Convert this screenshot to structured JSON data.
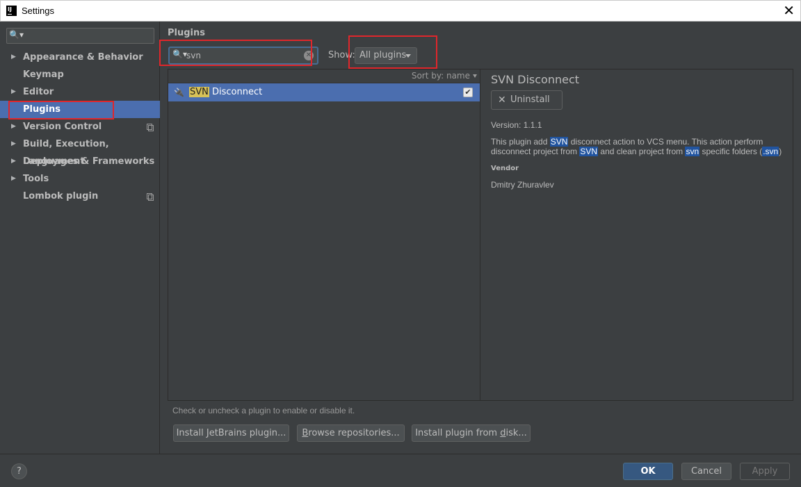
{
  "window": {
    "app_icon": "IJ",
    "title": "Settings",
    "close_glyph": "✕"
  },
  "sidebar": {
    "search_icon": "search-icon",
    "items": [
      {
        "label": "Appearance & Behavior",
        "expandable": true
      },
      {
        "label": "Keymap",
        "expandable": false
      },
      {
        "label": "Editor",
        "expandable": true
      },
      {
        "label": "Plugins",
        "expandable": false,
        "selected": true
      },
      {
        "label": "Version Control",
        "expandable": true,
        "project_scope": true
      },
      {
        "label": "Build, Execution, Deployment",
        "expandable": true
      },
      {
        "label": "Languages & Frameworks",
        "expandable": true
      },
      {
        "label": "Tools",
        "expandable": true
      },
      {
        "label": "Lombok plugin",
        "expandable": false,
        "project_scope": true
      }
    ]
  },
  "plugins": {
    "title": "Plugins",
    "search": {
      "value": "svn"
    },
    "show_label": "Show:",
    "show_value": "All plugins",
    "sort_label": "Sort by: name",
    "list": [
      {
        "highlight": "SVN",
        "rest": " Disconnect",
        "enabled": true
      }
    ],
    "detail": {
      "title": "SVN Disconnect",
      "uninstall_label": "Uninstall",
      "version": "Version: 1.1.1",
      "desc_parts": [
        {
          "t": "This plugin add ",
          "h": false
        },
        {
          "t": "SVN",
          "h": true
        },
        {
          "t": " disconnect action to VCS menu. This action perform disconnect project from ",
          "h": false
        },
        {
          "t": "SVN",
          "h": true
        },
        {
          "t": " and clean project from ",
          "h": false
        },
        {
          "t": "svn",
          "h": true
        },
        {
          "t": " specific folders (",
          "h": false
        },
        {
          "t": ".svn",
          "h": true
        },
        {
          "t": ")",
          "h": false
        }
      ],
      "vendor_label": "Vendor",
      "vendor": "Dmitry Zhuravlev"
    },
    "hint": "Check or uncheck a plugin to enable or disable it.",
    "buttons": {
      "install_jetbrains_pre": "Install ",
      "install_jetbrains_mn": "J",
      "install_jetbrains_post": "etBrains plugin...",
      "browse_pre": "",
      "browse_mn": "B",
      "browse_post": "rowse repositories...",
      "install_disk_pre": "Install plugin from ",
      "install_disk_mn": "d",
      "install_disk_post": "isk..."
    }
  },
  "footer": {
    "help": "?",
    "ok": "OK",
    "cancel": "Cancel",
    "apply": "Apply"
  }
}
